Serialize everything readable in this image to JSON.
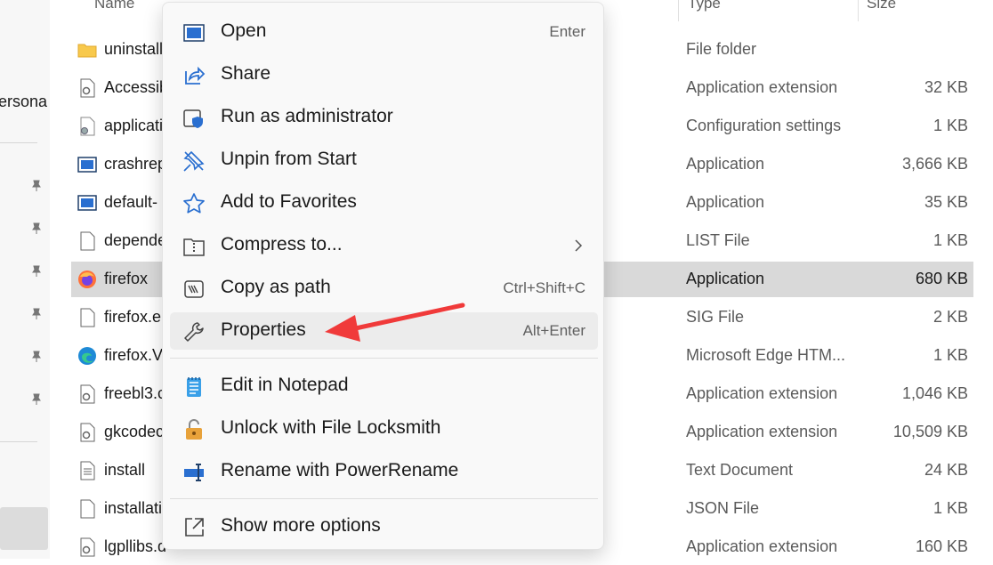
{
  "header": {
    "name": "Name",
    "type": "Type",
    "size": "Size"
  },
  "nav": {
    "partial_label": "ersona"
  },
  "files": [
    {
      "name": "uninstall",
      "type": "File folder",
      "size": "",
      "icon": "folder-icon"
    },
    {
      "name": "Accessib",
      "type": "Application extension",
      "size": "32 KB",
      "icon": "dll-icon"
    },
    {
      "name": "application",
      "type": "Configuration settings",
      "size": "1 KB",
      "icon": "config-icon"
    },
    {
      "name": "crashrep",
      "type": "Application",
      "size": "3,666 KB",
      "icon": "app-icon"
    },
    {
      "name": "default-",
      "type": "Application",
      "size": "35 KB",
      "icon": "app-icon"
    },
    {
      "name": "depende",
      "type": "LIST File",
      "size": "1 KB",
      "icon": "file-icon"
    },
    {
      "name": "firefox",
      "type": "Application",
      "size": "680 KB",
      "icon": "firefox-icon",
      "selected": true
    },
    {
      "name": "firefox.e",
      "type": "SIG File",
      "size": "2 KB",
      "icon": "file-icon"
    },
    {
      "name": "firefox.V",
      "type": "Microsoft Edge HTM...",
      "size": "1 KB",
      "icon": "edge-icon"
    },
    {
      "name": "freebl3.c",
      "type": "Application extension",
      "size": "1,046 KB",
      "icon": "dll-icon"
    },
    {
      "name": "gkcodec",
      "type": "Application extension",
      "size": "10,509 KB",
      "icon": "dll-icon"
    },
    {
      "name": "install",
      "type": "Text Document",
      "size": "24 KB",
      "icon": "text-file-icon"
    },
    {
      "name": "installati",
      "type": "JSON File",
      "size": "1 KB",
      "icon": "file-icon"
    },
    {
      "name": "lgpllibs.d",
      "type": "Application extension",
      "size": "160 KB",
      "icon": "dll-icon"
    }
  ],
  "menu": {
    "items": [
      {
        "label": "Open",
        "shortcut": "Enter",
        "icon": "open-icon"
      },
      {
        "label": "Share",
        "shortcut": "",
        "icon": "share-icon"
      },
      {
        "label": "Run as administrator",
        "shortcut": "",
        "icon": "shield-icon"
      },
      {
        "label": "Unpin from Start",
        "shortcut": "",
        "icon": "unpin-icon"
      },
      {
        "label": "Add to Favorites",
        "shortcut": "",
        "icon": "star-icon"
      },
      {
        "label": "Compress to...",
        "shortcut": "",
        "icon": "zip-icon",
        "submenu": true
      },
      {
        "label": "Copy as path",
        "shortcut": "Ctrl+Shift+C",
        "icon": "copy-path-icon"
      },
      {
        "label": "Properties",
        "shortcut": "Alt+Enter",
        "icon": "wrench-icon",
        "highlighted": true
      },
      {
        "label": "Edit in Notepad",
        "shortcut": "",
        "icon": "notepad-icon"
      },
      {
        "label": "Unlock with File Locksmith",
        "shortcut": "",
        "icon": "lock-icon"
      },
      {
        "label": "Rename with PowerRename",
        "shortcut": "",
        "icon": "rename-icon"
      },
      {
        "label": "Show more options",
        "shortcut": "",
        "icon": "more-options-icon"
      }
    ]
  },
  "colors": {
    "accent": "#0067c0",
    "arrow": "#f03a3a",
    "selected_row": "#d9d9d9",
    "menu_bg": "#f9f9f9"
  }
}
